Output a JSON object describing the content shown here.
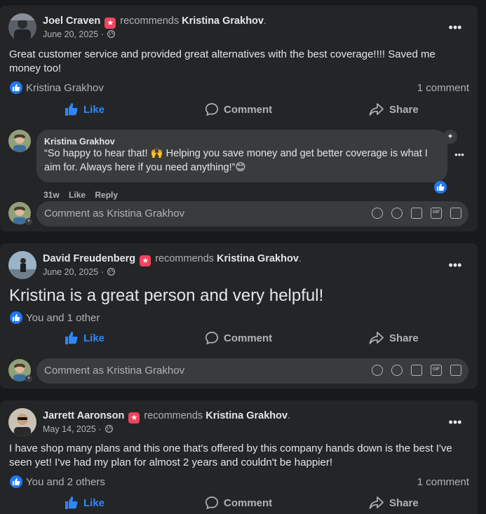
{
  "recommends_word": "recommends",
  "page_name": "Kristina Grakhov",
  "actions": {
    "like": "Like",
    "comment": "Comment",
    "share": "Share"
  },
  "comment_placeholder": "Comment as Kristina Grakhov",
  "posts": [
    {
      "author": "Joel Craven",
      "date": "June 20, 2025 ·",
      "text": "Great customer service and provided great alternatives with the best coverage!!!! Saved me money too!",
      "reactions": "Kristina Grakhov",
      "comment_count": "1 comment",
      "reply": {
        "author": "Kristina Grakhov",
        "text": "“So happy to hear that! 🙌 Helping you save money and get better coverage is what I aim for. Always here if you need anything!”😊",
        "time": "31w",
        "like": "Like",
        "reply": "Reply"
      }
    },
    {
      "author": "David Freudenberg",
      "date": "June 20, 2025 ·",
      "text": "Kristina is a great person and very helpful!",
      "reactions": "You and 1 other"
    },
    {
      "author": "Jarrett Aaronson",
      "date": "May 14, 2025 ·",
      "text": "I have shop many plans and this one that's offered by this company hands down is the best I've seen yet! I've had my plan for almost 2 years and couldn't be happier!",
      "reactions": "You and 2 others",
      "comment_count": "1 comment"
    }
  ],
  "colors": {
    "background": "#18191a",
    "card": "#242526",
    "bubble": "#3a3b3c",
    "like_blue": "#2d88ff",
    "recommend_badge": "#f3425f"
  }
}
